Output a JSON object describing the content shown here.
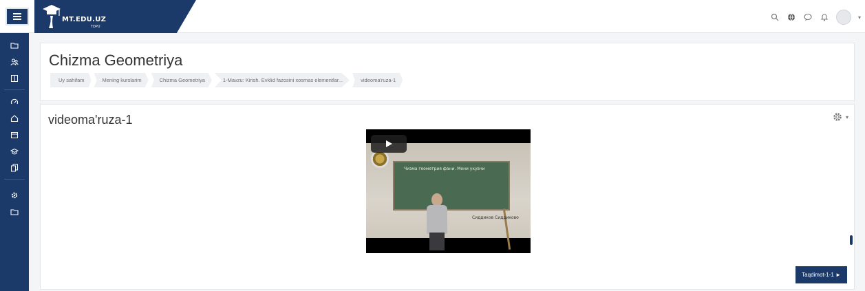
{
  "navbar": {
    "brand_title": "MT.EDU.UZ",
    "brand_sub": "TDPU",
    "icons": [
      "search-icon",
      "globe-icon",
      "chat-icon",
      "bell-icon",
      "user-avatar"
    ]
  },
  "sidebar": {
    "icons": [
      "folder-icon",
      "users-icon",
      "book-icon",
      "gauge-icon",
      "home-icon",
      "calendar-icon",
      "graduation-cap-icon",
      "files-icon",
      "gear-icon",
      "folder-icon"
    ]
  },
  "header": {
    "title": "Chizma Geometriya",
    "breadcrumbs": [
      "Uy sahifam",
      "Mening kurslarim",
      "Chizma Geometriya",
      "1-Mavzu: Kirish. Evklid fazosini xosmas elementlar...",
      "videoma'ruza-1"
    ]
  },
  "activity": {
    "title": "videoma'ruza-1",
    "video": {
      "board_text": "Чизма геометрия фани. Мени укувчи",
      "caption": "Сиддиков Сиддиково"
    },
    "next_button": "Taqdimot-1-1 ►"
  },
  "colors": {
    "brand": "#1b3a6a",
    "background": "#f4f5f7"
  }
}
